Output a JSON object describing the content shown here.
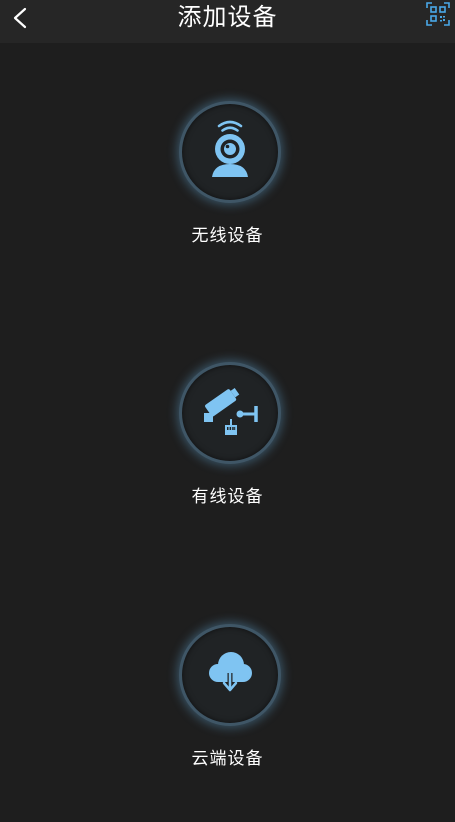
{
  "header": {
    "title": "添加设备",
    "back_icon": "chevron-left-icon",
    "qr_icon": "qr-scan-icon"
  },
  "options": [
    {
      "label": "无线设备",
      "icon": "wifi-camera-icon"
    },
    {
      "label": "有线设备",
      "icon": "wired-camera-icon"
    },
    {
      "label": "云端设备",
      "icon": "cloud-download-icon"
    }
  ],
  "colors": {
    "background": "#1e1e1e",
    "header": "#262626",
    "accent": "#7fc4f2",
    "ring": "#3f5666",
    "text": "#ffffff"
  }
}
